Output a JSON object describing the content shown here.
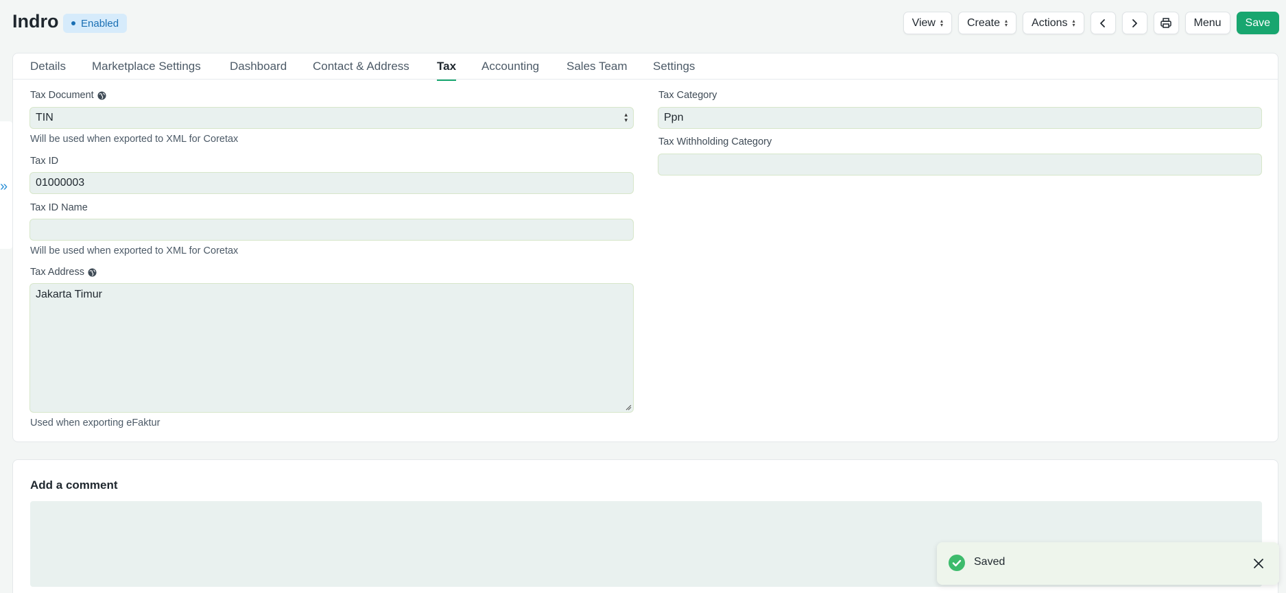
{
  "header": {
    "title": "Indro",
    "status": "Enabled",
    "buttons": {
      "view": "View",
      "create": "Create",
      "actions": "Actions",
      "menu": "Menu",
      "save": "Save"
    }
  },
  "tabs": [
    {
      "label": "Details"
    },
    {
      "label": "Marketplace Settings"
    },
    {
      "label": "Dashboard"
    },
    {
      "label": "Contact & Address"
    },
    {
      "label": "Tax"
    },
    {
      "label": "Accounting"
    },
    {
      "label": "Sales Team"
    },
    {
      "label": "Settings"
    }
  ],
  "form": {
    "tax_document": {
      "label": "Tax Document",
      "value": "TIN",
      "help": "Will be used when exported to XML for Coretax"
    },
    "tax_id": {
      "label": "Tax ID",
      "value": "01000003"
    },
    "tax_id_name": {
      "label": "Tax ID Name",
      "value": "",
      "help": "Will be used when exported to XML for Coretax"
    },
    "tax_address": {
      "label": "Tax Address",
      "value": "Jakarta Timur",
      "help": "Used when exporting eFaktur"
    },
    "tax_category": {
      "label": "Tax Category",
      "value": "Ppn"
    },
    "tax_withholding_category": {
      "label": "Tax Withholding Category",
      "value": ""
    }
  },
  "comment": {
    "title": "Add a comment"
  },
  "toast": {
    "message": "Saved"
  },
  "colors": {
    "accent": "#18a66f",
    "badge_bg": "#d6ebfb",
    "badge_text": "#1a6fb3",
    "field_bg": "#e9f1ef",
    "toast_bg": "#eef5ec"
  }
}
